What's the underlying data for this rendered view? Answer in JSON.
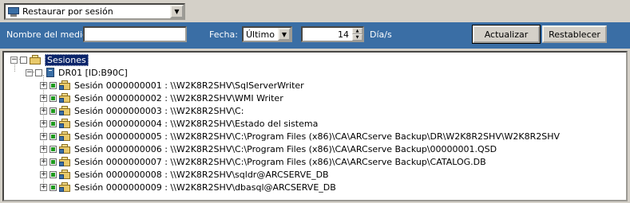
{
  "toolbar": {
    "mode_select_value": "Restaurar por sesión",
    "mode_icon": "restore-icon"
  },
  "filter": {
    "media_name_label": "Nombre del medio:",
    "media_name_value": "",
    "date_label": "Fecha:",
    "date_value": "Último",
    "days_value": "14",
    "days_unit": "Día/s",
    "update_button": "Actualizar",
    "reset_button": "Restablecer"
  },
  "colors": {
    "filter_bar": "#3a6ea5",
    "session_check": "#1f9a1f",
    "selection": "#0a246a"
  },
  "tree": {
    "root_label": "Sesiones",
    "server_label": "DR01 [ID:B90C]",
    "sessions": [
      "Sesión 0000000001 : \\\\W2K8R2SHV\\SqlServerWriter",
      "Sesión 0000000002 : \\\\W2K8R2SHV\\WMI Writer",
      "Sesión 0000000003 : \\\\W2K8R2SHV\\C:",
      "Sesión 0000000004 : \\\\W2K8R2SHV\\Estado del sistema",
      "Sesión 0000000005 : \\\\W2K8R2SHV\\C:\\Program Files (x86)\\CA\\ARCserve Backup\\DR\\W2K8R2SHV\\W2K8R2SHV",
      "Sesión 0000000006 : \\\\W2K8R2SHV\\C:\\Program Files (x86)\\CA\\ARCserve Backup\\00000001.QSD",
      "Sesión 0000000007 : \\\\W2K8R2SHV\\C:\\Program Files (x86)\\CA\\ARCserve Backup\\CATALOG.DB",
      "Sesión 0000000008 : \\\\W2K8R2SHV\\sqldr@ARCSERVE_DB",
      "Sesión 0000000009 : \\\\W2K8R2SHV\\dbasql@ARCSERVE_DB"
    ]
  }
}
